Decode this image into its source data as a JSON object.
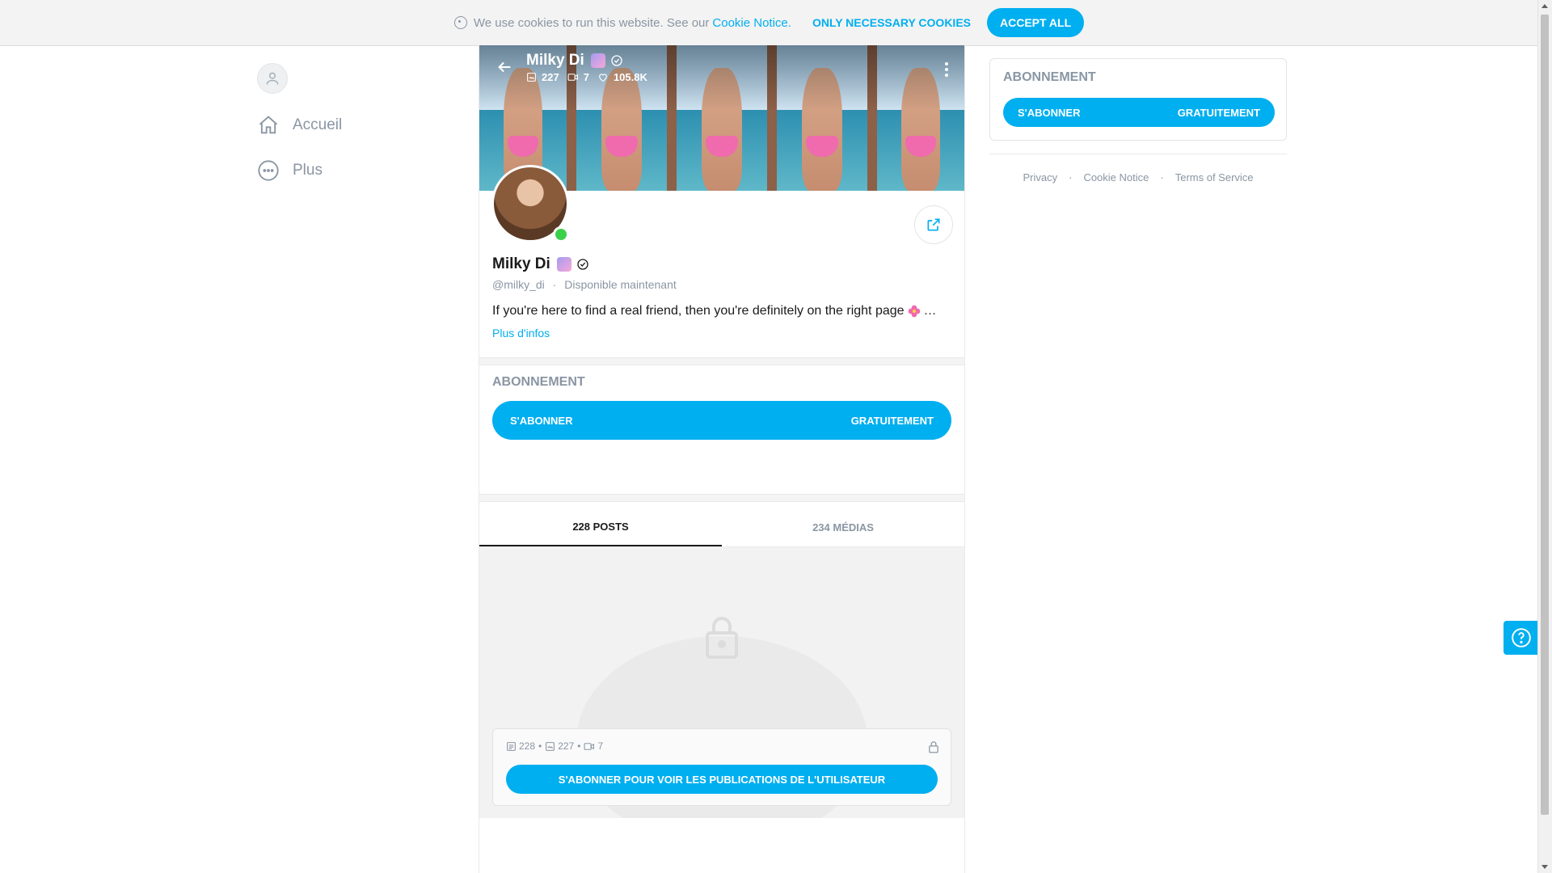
{
  "cookie_banner": {
    "text": "We use cookies to run this website. See our",
    "link": "Cookie Notice.",
    "only_necessary": "ONLY NECESSARY COOKIES",
    "accept_all": "ACCEPT ALL"
  },
  "sidebar": {
    "items": [
      {
        "label": "Accueil",
        "icon": "home-icon"
      },
      {
        "label": "Plus",
        "icon": "more-horizontal-icon"
      }
    ]
  },
  "profile": {
    "name": "Milky Di",
    "handle": "@milky_di",
    "status": "Disponible maintenant",
    "bio": "If you're here to find a real friend, then you're definitely on the right page",
    "bio_ellipsis": "…",
    "more_info": "Plus d'infos",
    "stats": {
      "photos": "227",
      "videos": "7",
      "likes": "105.8K"
    }
  },
  "subscription": {
    "title": "ABONNEMENT",
    "button_left": "S'ABONNER",
    "button_right": "GRATUITEMENT"
  },
  "tabs": [
    {
      "label": "228 POSTS",
      "active": true
    },
    {
      "label": "234 MÉDIAS",
      "active": false
    }
  ],
  "locked": {
    "posts": "228",
    "photos": "227",
    "videos": "7",
    "cta": "S'ABONNER POUR VOIR LES PUBLICATIONS DE L'UTILISATEUR"
  },
  "right": {
    "title": "ABONNEMENT",
    "button_left": "S'ABONNER",
    "button_right": "GRATUITEMENT"
  },
  "footer": {
    "links": [
      "Privacy",
      "Cookie Notice",
      "Terms of Service"
    ],
    "separator": "·"
  },
  "colors": {
    "accent": "#00aff0",
    "muted": "#8a96a3",
    "online": "#3bd04a"
  }
}
